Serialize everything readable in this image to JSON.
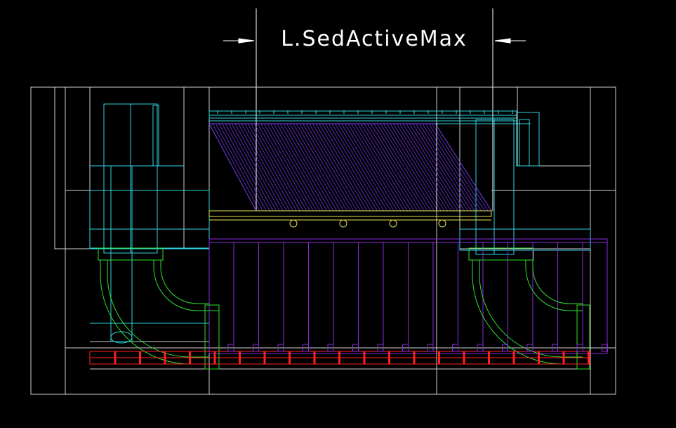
{
  "dimension": {
    "label": "L.SedActiveMax"
  },
  "colors": {
    "background": "#000000",
    "outline": "#d8d8d8",
    "cyan": "#2fd5e0",
    "green": "#2fe02f",
    "purple": "#8a2be2",
    "violet": "#6a35d8",
    "yellow": "#e8e24a",
    "red": "#ff2020"
  }
}
